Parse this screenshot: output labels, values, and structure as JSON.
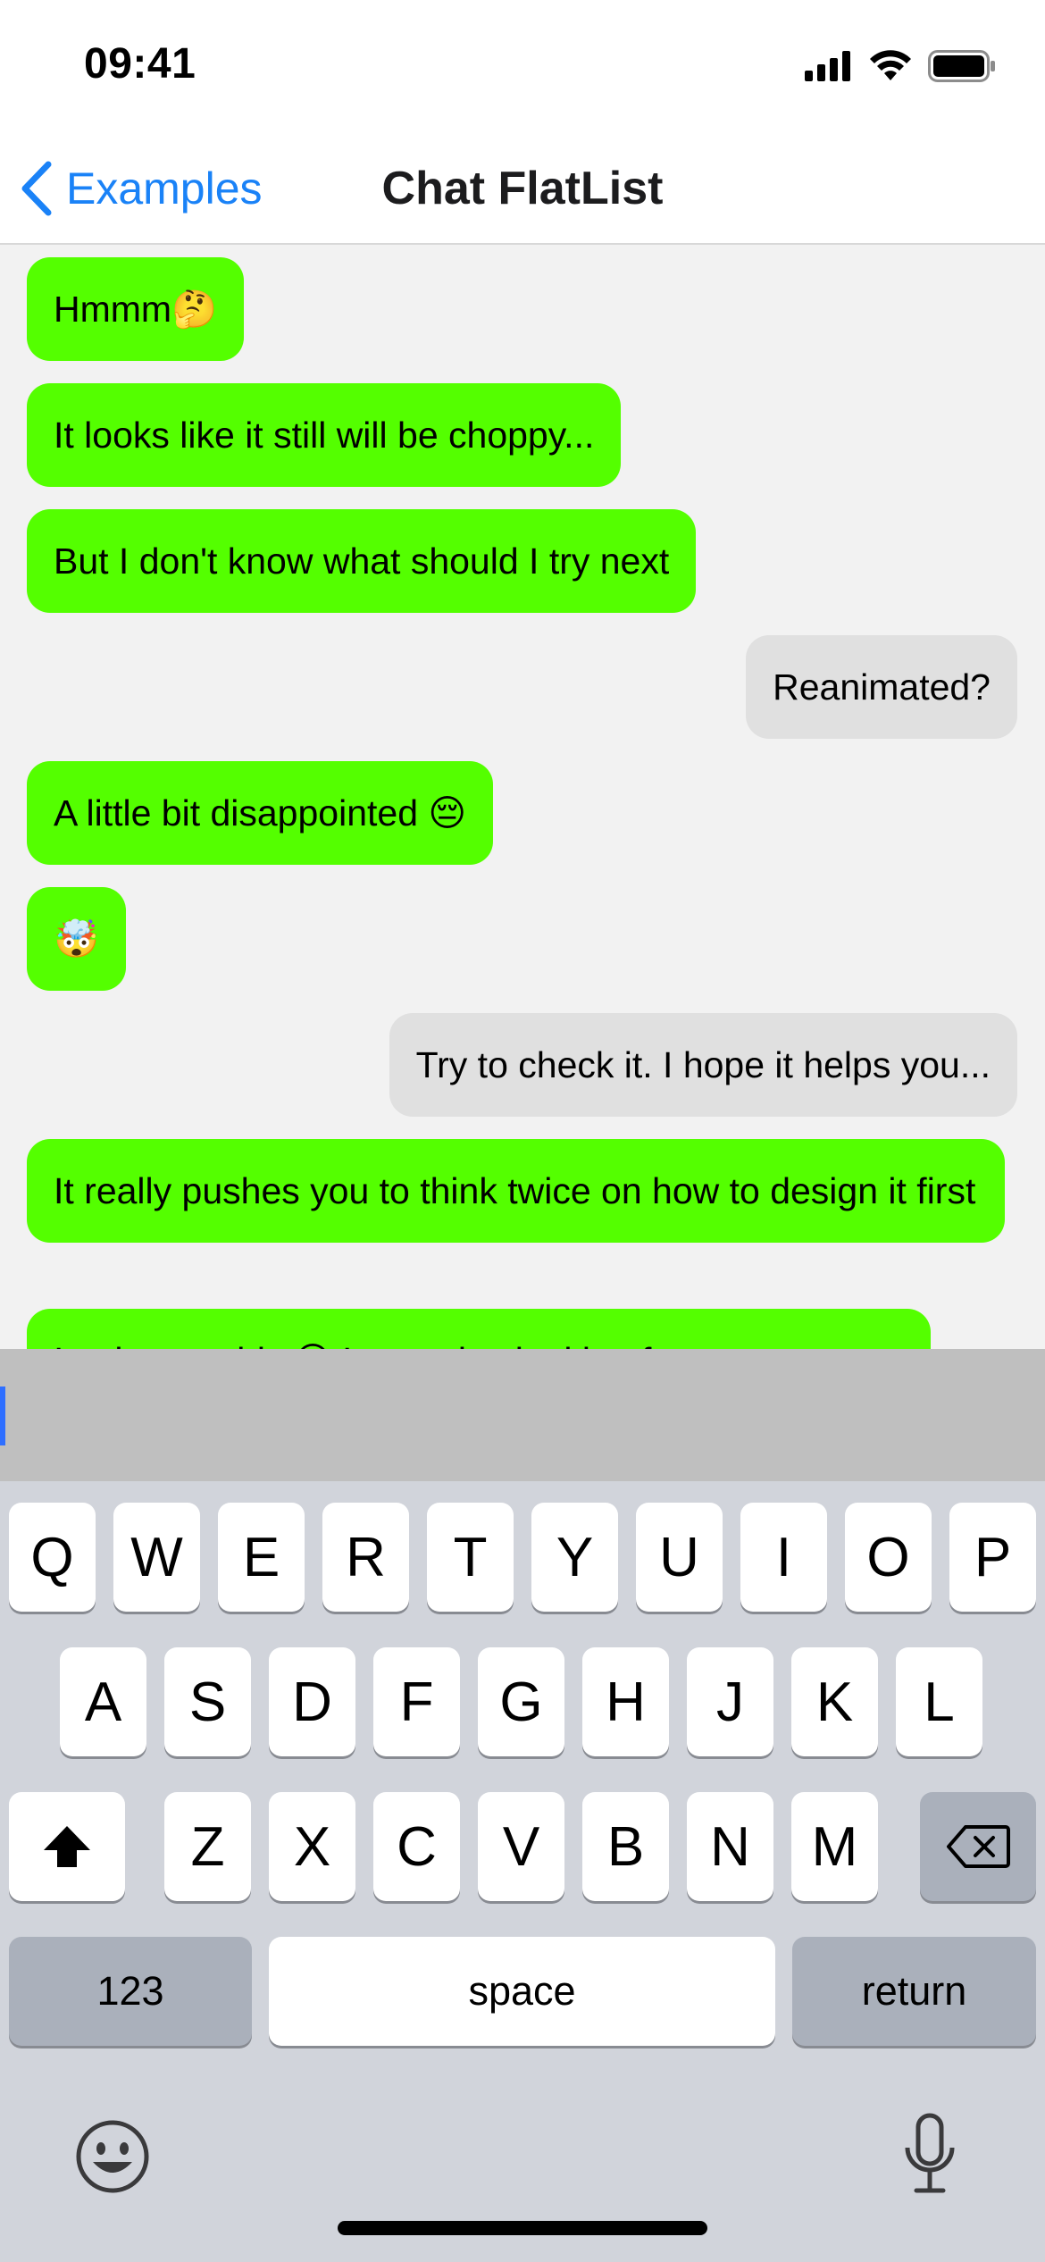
{
  "status_bar": {
    "time": "09:41",
    "icons": [
      "signal-icon",
      "wifi-icon",
      "battery-icon"
    ]
  },
  "nav": {
    "back_label": "Examples",
    "title": "Chat FlatList"
  },
  "messages": [
    {
      "side": "them",
      "text": "Hmmm🤔"
    },
    {
      "side": "them",
      "text": "It looks like it still will be choppy..."
    },
    {
      "side": "them",
      "text": "But I don't know what should I try next"
    },
    {
      "side": "me",
      "text": "Reanimated?"
    },
    {
      "side": "them",
      "text": "A little bit disappointed 😔"
    },
    {
      "side": "them",
      "text": "🤯"
    },
    {
      "side": "me",
      "text": "Try to check it. I hope it helps you..."
    },
    {
      "side": "them",
      "text": "It really pushes you to think twice on how to design it first"
    },
    {
      "side": "them",
      "text": "I only saw this 😉 I was also looking for"
    }
  ],
  "input": {
    "value": ""
  },
  "keyboard": {
    "row1": [
      "Q",
      "W",
      "E",
      "R",
      "T",
      "Y",
      "U",
      "I",
      "O",
      "P"
    ],
    "row2": [
      "A",
      "S",
      "D",
      "F",
      "G",
      "H",
      "J",
      "K",
      "L"
    ],
    "row3": [
      "Z",
      "X",
      "C",
      "V",
      "B",
      "N",
      "M"
    ],
    "numbers_label": "123",
    "space_label": "space",
    "return_label": "return"
  },
  "colors": {
    "incoming_bubble": "#54ff00",
    "outgoing_bubble": "#e0e0e0",
    "accent": "#1a82f7",
    "input_bar": "#bfbfbf",
    "keyboard_bg": "#d1d4db"
  }
}
